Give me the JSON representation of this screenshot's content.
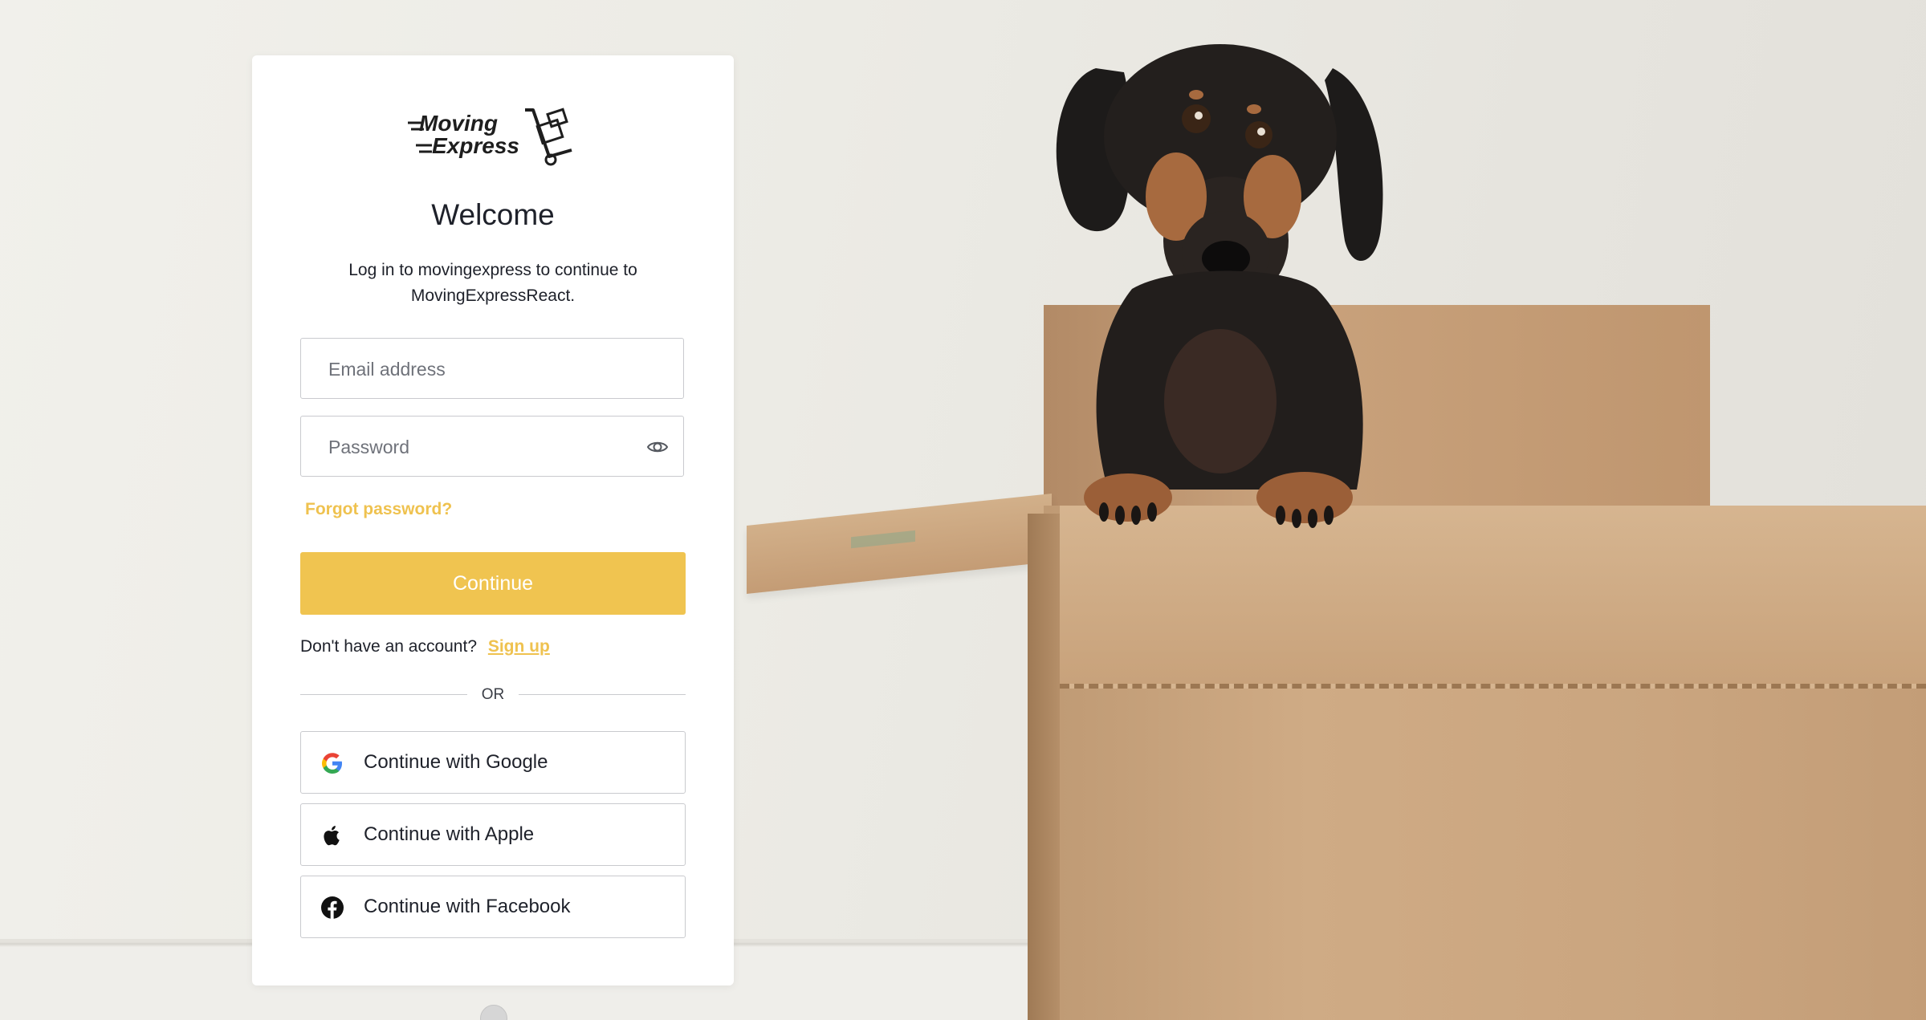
{
  "brand": {
    "logo_line1": "Moving",
    "logo_line2": "Express"
  },
  "login": {
    "title": "Welcome",
    "subtitle": "Log in to movingexpress to continue to MovingExpressReact.",
    "email_placeholder": "Email address",
    "password_placeholder": "Password",
    "forgot_password": "Forgot password?",
    "continue_label": "Continue",
    "no_account_text": "Don't have an account?",
    "signup_label": "Sign up",
    "divider_text": "OR"
  },
  "social": [
    {
      "label": "Continue with Google",
      "icon": "google-icon"
    },
    {
      "label": "Continue with Apple",
      "icon": "apple-icon"
    },
    {
      "label": "Continue with Facebook",
      "icon": "facebook-icon"
    }
  ],
  "colors": {
    "accent": "#f0c450",
    "link": "#efc24f",
    "text": "#1e212a",
    "border": "#c9cace"
  }
}
